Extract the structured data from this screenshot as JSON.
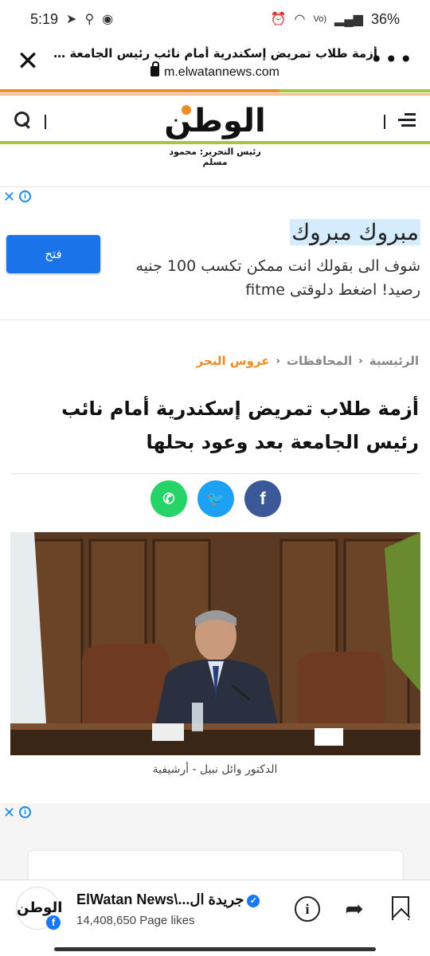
{
  "status_bar": {
    "time": "5:19",
    "left_icons": [
      "telegram-icon",
      "location-icon",
      "messenger-icon"
    ],
    "right_icons": [
      "alarm-icon",
      "wifi-icon",
      "volte-signal-icon"
    ],
    "battery": "36%"
  },
  "browser": {
    "title": "أزمة طلاب تمريض إسكندرية أمام نائب رئيس الجامعة بعد وعود بح...",
    "url": "m.elwatannews.com",
    "close_glyph": "✕",
    "more_glyph": "•••"
  },
  "site": {
    "logo_text": "الوطن",
    "editor_line": "رئيس التحرير: محمود مسلم",
    "accent_orange": "#f08a24",
    "accent_green": "#a8c63a"
  },
  "ad": {
    "close_glyph": "✕",
    "info_glyph": "i",
    "button_label": "فتح",
    "headline": "مبروك مبروك",
    "body": "شوف الى بقولك انت ممكن تكسب 100 جنيه رصيد! اضغط دلوقتى fitme"
  },
  "breadcrumb": {
    "items": [
      "الرئيسية",
      "المحافظات"
    ],
    "current": "عروس البحر",
    "separator": "‹"
  },
  "article": {
    "title": "أزمة طلاب تمريض إسكندرية أمام نائب رئيس الجامعة بعد وعود بحلها",
    "caption": "الدكتور وائل نبيل - أرشيفية"
  },
  "share": {
    "facebook": "f",
    "twitter": "🐦",
    "whatsapp": "✆"
  },
  "ad2": {
    "close_glyph": "✕",
    "info_glyph": "i"
  },
  "bottom_bar": {
    "avatar_text": "الوطن",
    "fb_badge": "f",
    "page_name": "ElWatan News\\...جريدة ال",
    "verified_glyph": "✓",
    "page_likes": "14,408,650 Page likes",
    "info_glyph": "i",
    "share_glyph": "➦"
  }
}
